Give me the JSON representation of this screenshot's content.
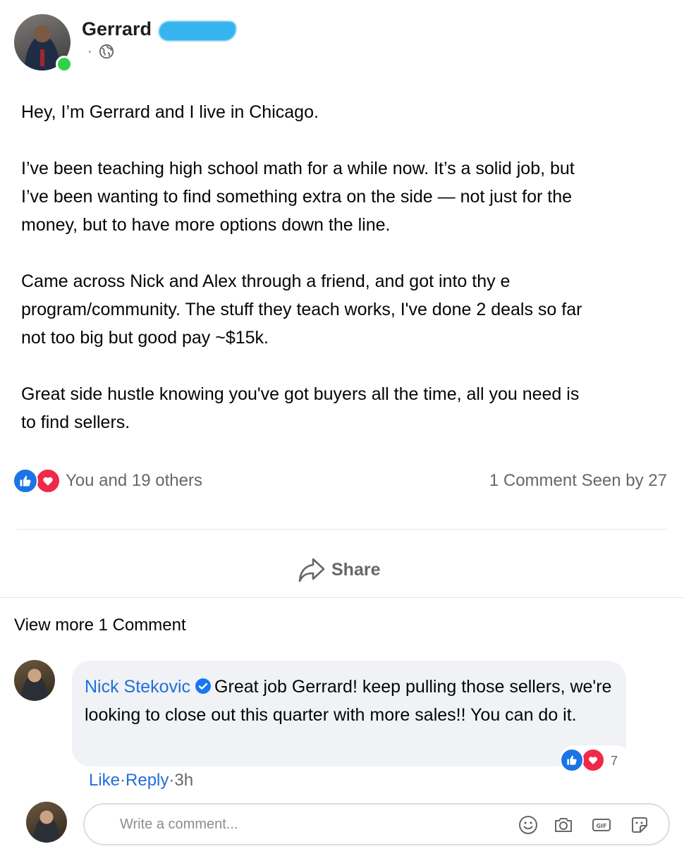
{
  "post": {
    "author_name": "Gerrard",
    "meta_dot": "·",
    "paragraphs": [
      "Hey, I’m Gerrard and I live in Chicago.",
      "I’ve been teaching high school math for a while now. It’s a solid job, but\nI’ve been wanting to find something extra on the side — not just for the\nmoney, but to have more options down the line.",
      "Came across Nick and Alex through a friend, and got into thy e\nprogram/community. The stuff they teach works, I've done 2 deals so far\nnot too big but good pay ~$15k.",
      "Great side hustle knowing you've got buyers all the time, all you need is\nto find sellers."
    ],
    "reactions_text": "You and 19 others",
    "stats_text": "1 Comment Seen by 27",
    "share_label": "Share"
  },
  "comments": {
    "view_more": "View more 1 Comment",
    "items": [
      {
        "author": "Nick Stekovic",
        "text": "Great job Gerrard! keep pulling those sellers, we're looking to close out this quarter with more sales!! You can do it.",
        "reaction_count": "7",
        "like_label": "Like",
        "reply_label": "Reply",
        "sep": "·",
        "time": "3h"
      }
    ]
  },
  "composer": {
    "placeholder": "Write a comment..."
  },
  "colors": {
    "link_blue": "#216fdb",
    "like_blue": "#1b74e4",
    "love_red": "#f02849",
    "online_green": "#31d24a",
    "bubble_gray": "#f0f2f5"
  },
  "icons": [
    "globe-icon",
    "like-icon",
    "love-icon",
    "share-icon",
    "verified-badge-icon",
    "emoji-icon",
    "camera-icon",
    "gif-icon",
    "sticker-icon"
  ]
}
